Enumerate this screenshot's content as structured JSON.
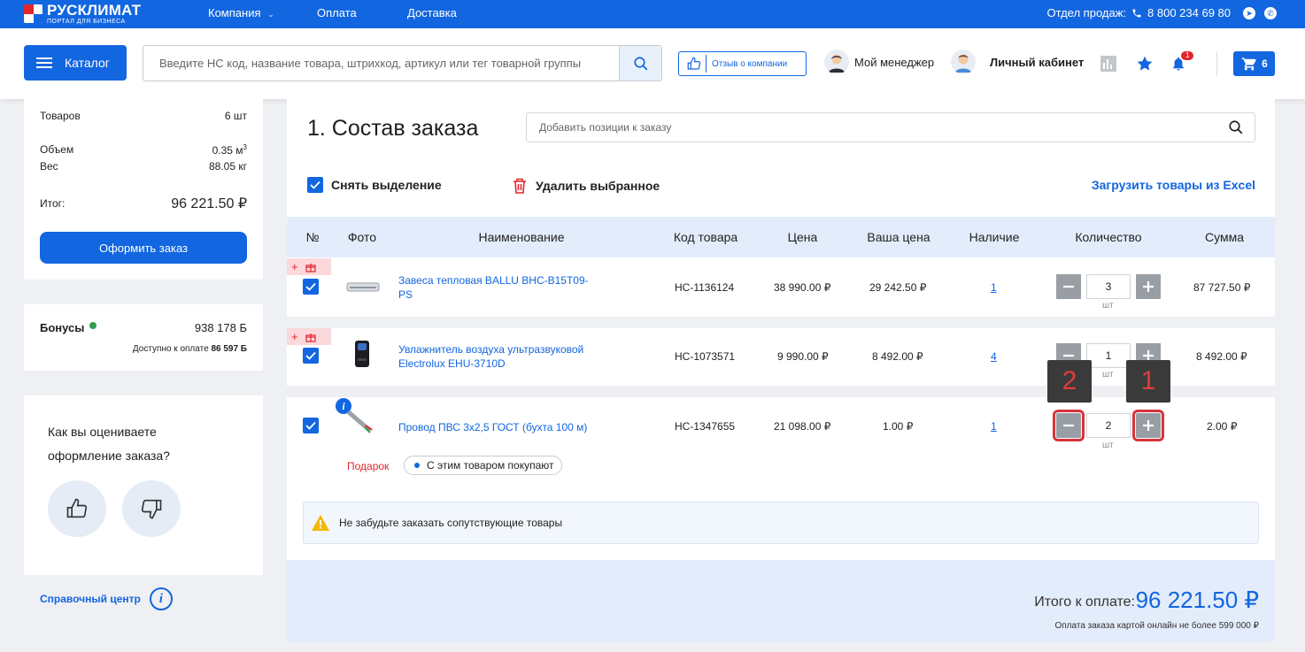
{
  "brand": {
    "name": "РУСКЛИМАТ",
    "tagline": "ПОРТАЛ ДЛЯ БИЗНЕСА"
  },
  "topnav": {
    "company": "Компания",
    "payment": "Оплата",
    "delivery": "Доставка"
  },
  "sales": {
    "label": "Отдел продаж:",
    "phone": "8 800 234 69 80"
  },
  "header": {
    "catalog": "Каталог",
    "search_placeholder": "Введите НС код, название товара, штрихкод, артикул или тег товарной группы",
    "review": "Отзыв о компании",
    "manager": "Мой менеджер",
    "account": "Личный кабинет",
    "notif_count": "1",
    "cart_count": "6"
  },
  "summary": {
    "items_label": "Товаров",
    "items_value": "6 шт",
    "volume_label": "Объем",
    "volume_value": "0.35 м",
    "volume_sup": "3",
    "weight_label": "Вес",
    "weight_value": "88.05 кг",
    "total_label": "Итог:",
    "total_value": "96 221.50 ₽",
    "order_button": "Оформить заказ"
  },
  "bonus": {
    "label": "Бонусы",
    "value": "938 178 Б",
    "available_label": "Доступно к оплате",
    "available_value": "86 597 Б"
  },
  "rating": {
    "question": "Как вы оцениваете оформление заказа?"
  },
  "help": {
    "label": "Справочный центр"
  },
  "order": {
    "title": "1. Состав заказа",
    "add_placeholder": "Добавить позиции к заказу",
    "deselect": "Снять выделение",
    "delete_selected": "Удалить выбранное",
    "load_excel": "Загрузить товары из Excel"
  },
  "table": {
    "columns": [
      "№",
      "Фото",
      "Наименование",
      "Код товара",
      "Цена",
      "Ваша цена",
      "Наличие",
      "Количество",
      "Сумма"
    ],
    "rows": [
      {
        "name": "Завеса тепловая BALLU BHC-B15T09-PS",
        "code": "НС-1136124",
        "price": "38 990.00 ₽",
        "your_price": "29 242.50 ₽",
        "stock": "1",
        "qty": "3",
        "unit": "шт",
        "sum": "87 727.50 ₽"
      },
      {
        "name": "Увлажнитель воздуха ультразвуковой Electrolux EHU-3710D",
        "code": "НС-1073571",
        "price": "9 990.00 ₽",
        "your_price": "8 492.00 ₽",
        "stock": "4",
        "qty": "1",
        "unit": "шт",
        "sum": "8 492.00 ₽"
      },
      {
        "name": "Провод ПВС 3х2,5 ГОСТ (бухта 100 м)",
        "code": "НС-1347655",
        "price": "21 098.00 ₽",
        "your_price": "1.00 ₽",
        "stock": "1",
        "qty": "2",
        "unit": "шт",
        "sum": "2.00 ₽"
      }
    ],
    "gift_label": "Подарок",
    "bought_together": "С этим товаром покупают",
    "gift_plus": "+"
  },
  "markers": {
    "plus": "1",
    "minus": "2"
  },
  "notice": "Не забудьте заказать сопутствующие товары",
  "footer": {
    "total_label": "Итого к оплате:",
    "total_value": "96 221.50 ₽",
    "note": "Оплата заказа картой онлайн не более 599 000 ₽"
  },
  "colors": {
    "primary": "#1266e0",
    "danger": "#e0262c",
    "marker_bg": "#3a3a3a"
  }
}
